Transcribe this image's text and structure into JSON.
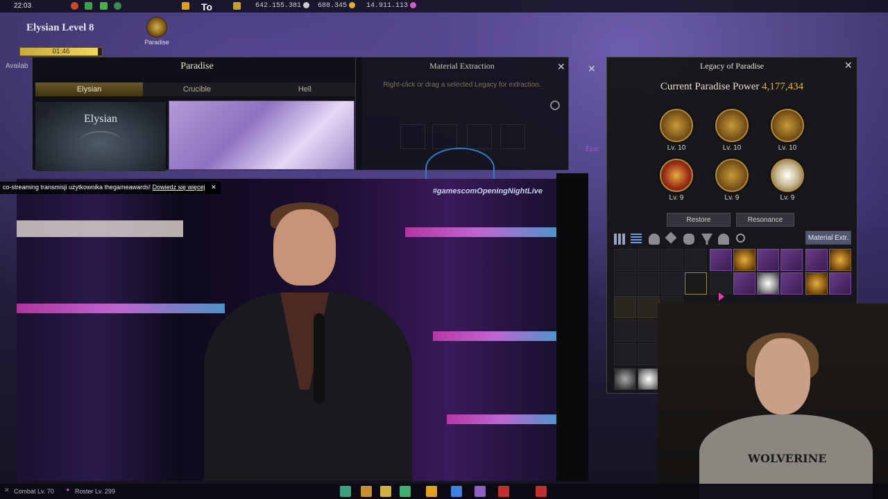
{
  "top_hud": {
    "clock": "22:03",
    "silver": "642.155.381",
    "gold": "688.345",
    "crystal": "14.911.113",
    "overlay_text": "To"
  },
  "elysian": {
    "level_label": "Elysian Level 8",
    "timer": "01:46",
    "timer_fill": 0.95,
    "shortcut_label": "Paradise",
    "available_label": "Availab"
  },
  "paradise_window": {
    "title": "Paradise",
    "tabs": [
      "Elysian",
      "Crucible",
      "Hell"
    ],
    "active_tab": "Elysian",
    "card_name": "Elysian"
  },
  "material_window": {
    "title": "Material Extraction",
    "hint": "Right-click or drag a selected Legacy for extraction.",
    "right_tag": "Epic"
  },
  "legacy_window": {
    "title": "Legacy of Paradise",
    "power_label": "Current Paradise Power",
    "power_value": "4,177,434",
    "emblems": [
      {
        "level": "Lv. 10",
        "style": "gold"
      },
      {
        "level": "Lv. 10",
        "style": "gold"
      },
      {
        "level": "Lv. 10",
        "style": "gold"
      },
      {
        "level": "Lv. 9",
        "style": "red"
      },
      {
        "level": "Lv. 9",
        "style": "gold"
      },
      {
        "level": "Lv. 9",
        "style": "white"
      }
    ],
    "restore_label": "Restore",
    "resonance_label": "Resonance",
    "material_extract_label": "Material Extr.",
    "filter_icons": [
      "grid-icon",
      "list-icon",
      "helmet-icon",
      "tag-icon",
      "mask-icon",
      "trophy-icon",
      "bell-icon",
      "magnifier-icon"
    ]
  },
  "stream": {
    "banner_text": "co-streaming transmisji użytkownika thegameawards!",
    "banner_link": "Dowiedz się więcej",
    "hashtag": "#gamescomOpeningNightLive"
  },
  "webcam": {
    "shirt_text": "WOLVERINE"
  },
  "bottom_hud": {
    "combat_level": "Combat Lv. 70",
    "roster_level": "Roster Lv. 299"
  },
  "colors": {
    "accent_gold": "#e2b83a",
    "tab_active": "#6a5826",
    "purple_item": "#6a3a8a"
  }
}
